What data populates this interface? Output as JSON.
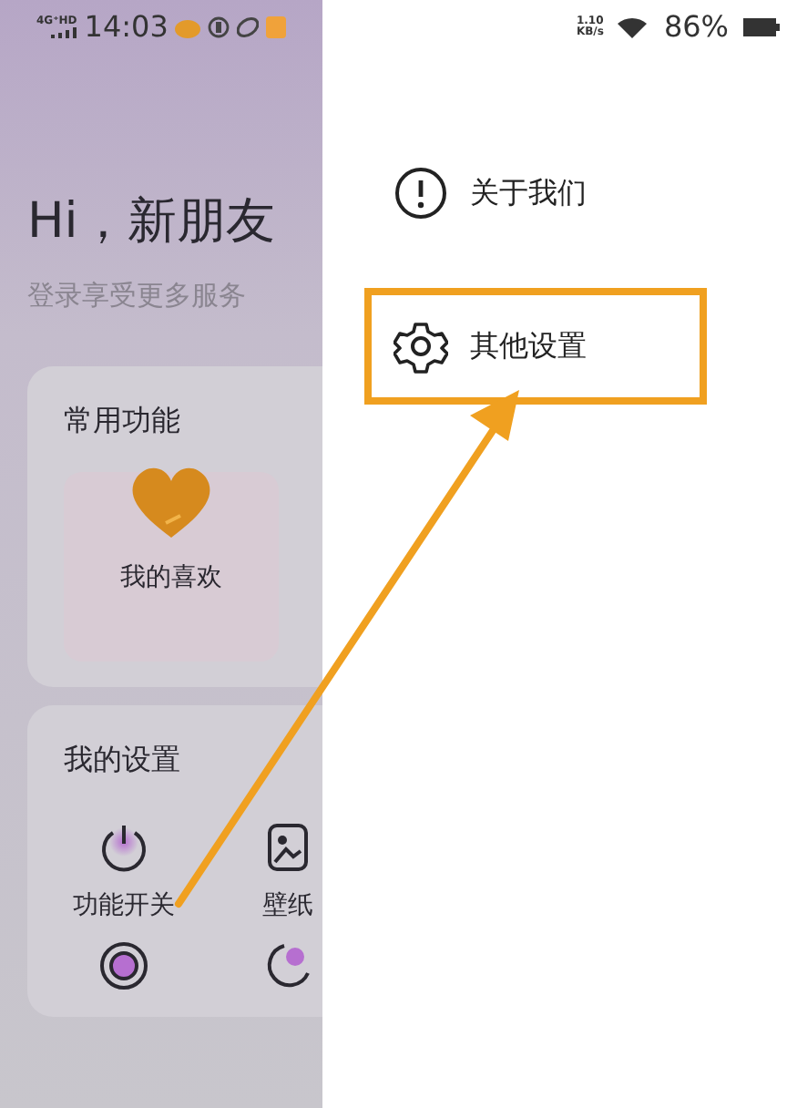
{
  "status_bar": {
    "network": "4G⁺HD",
    "time": "14:03",
    "speed": "1.10 KB/s",
    "battery": "86%"
  },
  "greeting": {
    "title": "Hi，新朋友",
    "subtitle": "登录享受更多服务"
  },
  "sections": [
    {
      "title": "常用功能",
      "items": [
        {
          "kind": "heart",
          "label": "我的喜欢"
        }
      ]
    },
    {
      "title": "我的设置",
      "items": [
        {
          "kind": "power",
          "label": "功能开关"
        },
        {
          "kind": "wallpaper",
          "label": "壁纸"
        },
        {
          "kind": "sync"
        },
        {
          "kind": "moon"
        }
      ]
    }
  ],
  "drawer": {
    "items": [
      {
        "kind": "info",
        "label": "关于我们",
        "highlighted": false
      },
      {
        "kind": "settings",
        "label": "其他设置",
        "highlighted": true
      }
    ]
  },
  "annotation": {
    "kind": "arrow"
  }
}
